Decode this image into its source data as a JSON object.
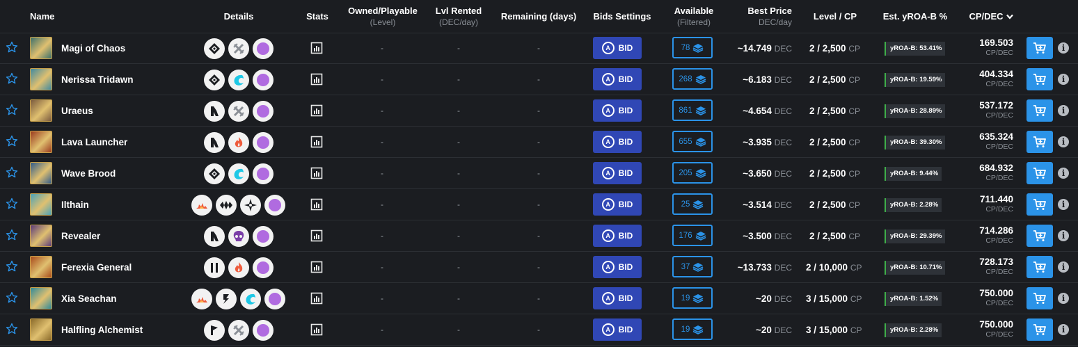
{
  "headers": {
    "name": "Name",
    "details": "Details",
    "stats": "Stats",
    "owned": "Owned/Playable",
    "owned_sub": "(Level)",
    "lvl_rented": "Lvl Rented",
    "lvl_rented_sub": "(DEC/day)",
    "remaining": "Remaining (days)",
    "bids": "Bids Settings",
    "available": "Available",
    "available_sub": "(Filtered)",
    "best_price": "Best Price",
    "best_price_sub": "DEC/day",
    "level_cp": "Level / CP",
    "yroa": "Est. yROA-B %",
    "cpdec": "CP/DEC"
  },
  "labels": {
    "bid": "BID",
    "dash": "-",
    "dec": "DEC",
    "cp": "CP",
    "cpdec_unit": "CP/DEC",
    "info": "i",
    "bid_icon": "A"
  },
  "colors": {
    "background": "#1b1d21",
    "bid_button": "#3047b5",
    "accent_blue": "#2b93e8",
    "yroa_green": "#3fae4a",
    "mana_purple": "#b06be0",
    "fire_red": "#ee5b3c",
    "water_cyan": "#1ec8e6"
  },
  "rows": [
    {
      "name": "Magi of Chaos",
      "details": [
        "rarity-diamond-icon",
        "neutral-crossed-swords-icon",
        "mana-orb-icon"
      ],
      "owned": "-",
      "rented": "-",
      "remaining": "-",
      "available": "78",
      "price": "~14.749",
      "level_cp": "2 / 2,500",
      "yroa": "yROA-B: 53.41%",
      "cpdec": "169.503",
      "thumb": "#3b6f6a"
    },
    {
      "name": "Nerissa Tridawn",
      "details": [
        "rarity-diamond-icon",
        "water-wave-icon",
        "mana-orb-icon"
      ],
      "owned": "-",
      "rented": "-",
      "remaining": "-",
      "available": "268",
      "price": "~6.183",
      "level_cp": "2 / 2,500",
      "yroa": "yROA-B: 19.59%",
      "cpdec": "404.334",
      "thumb": "#3f8aa0"
    },
    {
      "name": "Uraeus",
      "details": [
        "ability-arrow-icon",
        "neutral-crossed-swords-icon",
        "mana-orb-icon"
      ],
      "owned": "-",
      "rented": "-",
      "remaining": "-",
      "available": "861",
      "price": "~4.654",
      "level_cp": "2 / 2,500",
      "yroa": "yROA-B: 28.89%",
      "cpdec": "537.172",
      "thumb": "#7a5a3e"
    },
    {
      "name": "Lava Launcher",
      "details": [
        "ability-arrow-icon",
        "fire-flame-icon",
        "mana-orb-icon"
      ],
      "owned": "-",
      "rented": "-",
      "remaining": "-",
      "available": "655",
      "price": "~3.935",
      "level_cp": "2 / 2,500",
      "yroa": "yROA-B: 39.30%",
      "cpdec": "635.324",
      "thumb": "#9a3a1e"
    },
    {
      "name": "Wave Brood",
      "details": [
        "rarity-diamond-icon",
        "water-wave-icon",
        "mana-orb-icon"
      ],
      "owned": "-",
      "rented": "-",
      "remaining": "-",
      "available": "205",
      "price": "~3.650",
      "level_cp": "2 / 2,500",
      "yroa": "yROA-B: 9.44%",
      "cpdec": "684.932",
      "thumb": "#2f5a8a"
    },
    {
      "name": "Ilthain",
      "details": [
        "fire-burst-icon",
        "dragon-wing-icon",
        "life-sun-icon",
        "mana-orb-icon"
      ],
      "owned": "-",
      "rented": "-",
      "remaining": "-",
      "available": "25",
      "price": "~3.514",
      "level_cp": "2 / 2,500",
      "yroa": "yROA-B: 2.28%",
      "cpdec": "711.440",
      "thumb": "#4aa2b8"
    },
    {
      "name": "Revealer",
      "details": [
        "ability-arrow-icon",
        "death-skull-icon",
        "mana-orb-icon"
      ],
      "owned": "-",
      "rented": "-",
      "remaining": "-",
      "available": "176",
      "price": "~3.500",
      "level_cp": "2 / 2,500",
      "yroa": "yROA-B: 29.39%",
      "cpdec": "714.286",
      "thumb": "#5a3a7a"
    },
    {
      "name": "Ferexia General",
      "details": [
        "pause-bars-icon",
        "fire-flame-icon",
        "mana-orb-icon"
      ],
      "owned": "-",
      "rented": "-",
      "remaining": "-",
      "available": "37",
      "price": "~13.733",
      "level_cp": "2 / 10,000",
      "yroa": "yROA-B: 10.71%",
      "cpdec": "728.173",
      "thumb": "#a84a1a"
    },
    {
      "name": "Xia Seachan",
      "details": [
        "fire-burst-icon",
        "lightning-bolt-icon",
        "water-wave-icon",
        "mana-orb-icon"
      ],
      "owned": "-",
      "rented": "-",
      "remaining": "-",
      "available": "19",
      "price": "~20",
      "level_cp": "3 / 15,000",
      "yroa": "yROA-B: 1.52%",
      "cpdec": "750.000",
      "thumb": "#2f8a9a"
    },
    {
      "name": "Halfling Alchemist",
      "details": [
        "ability-flag-icon",
        "neutral-crossed-swords-icon",
        "mana-orb-icon"
      ],
      "owned": "-",
      "rented": "-",
      "remaining": "-",
      "available": "19",
      "price": "~20",
      "level_cp": "3 / 15,000",
      "yroa": "yROA-B: 2.28%",
      "cpdec": "750.000",
      "thumb": "#8a6a2a"
    }
  ]
}
